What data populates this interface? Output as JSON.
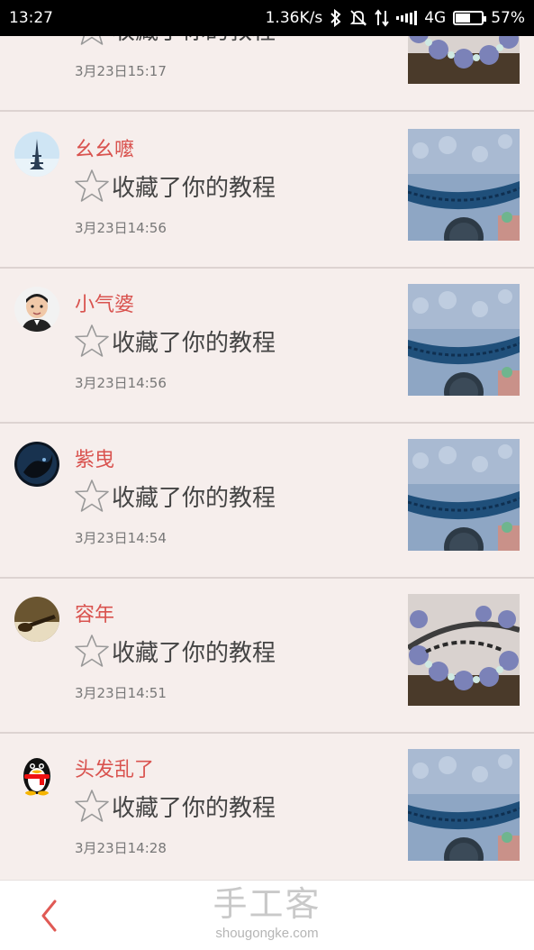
{
  "status_bar": {
    "time": "13:27",
    "speed": "1.36K/s",
    "network": "4G",
    "battery": "57%",
    "battery_level": 0.57,
    "icons": [
      "bluetooth-icon",
      "mute-bell-icon",
      "data-arrows-icon",
      "signal-icon",
      "battery-icon"
    ]
  },
  "notifications": [
    {
      "username": "",
      "action": "收藏了你的教程",
      "time": "3月23日15:17",
      "avatar": "hidden-avatar",
      "thumb": "beads-bracelet"
    },
    {
      "username": "幺幺嚒",
      "action": "收藏了你的教程",
      "time": "3月23日14:56",
      "avatar": "eiffel-tower-avatar",
      "thumb": "blue-braid-bracelet"
    },
    {
      "username": "小气婆",
      "action": "收藏了你的教程",
      "time": "3月23日14:56",
      "avatar": "baby-avatar",
      "thumb": "blue-braid-bracelet"
    },
    {
      "username": "紫曳",
      "action": "收藏了你的教程",
      "time": "3月23日14:54",
      "avatar": "dark-cat-avatar",
      "thumb": "blue-braid-bracelet"
    },
    {
      "username": "容年",
      "action": "收藏了你的教程",
      "time": "3月23日14:51",
      "avatar": "guitar-avatar",
      "thumb": "beads-bracelet"
    },
    {
      "username": "头发乱了",
      "action": "收藏了你的教程",
      "time": "3月23日14:28",
      "avatar": "qq-penguin-avatar",
      "thumb": "blue-braid-bracelet"
    }
  ],
  "bottom_bar": {
    "brand_title": "手工客",
    "brand_url": "shougongke.com",
    "back_icon": "chevron-left-icon"
  },
  "colors": {
    "background": "#f6eeec",
    "username": "#d9534f",
    "back_arrow": "#e05a55",
    "status_bar": "#000000"
  }
}
